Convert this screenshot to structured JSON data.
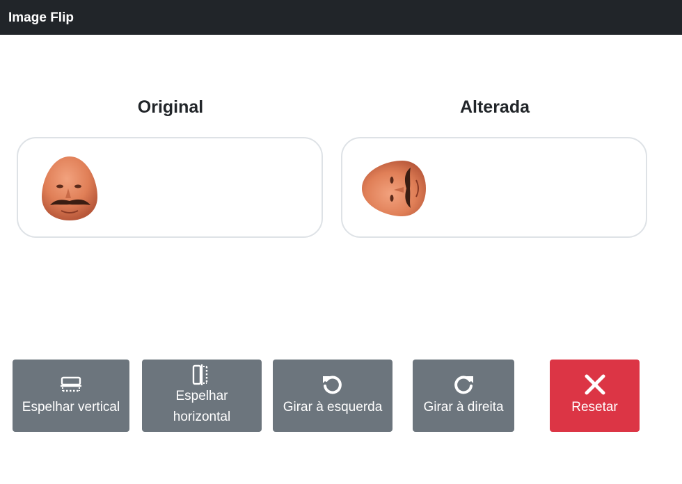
{
  "app": {
    "title": "Image Flip"
  },
  "original": {
    "heading": "Original"
  },
  "altered": {
    "heading": "Alterada"
  },
  "buttons": {
    "mirror_vertical": "Espelhar vertical",
    "mirror_horizontal": "Espelhar horizontal",
    "rotate_left": "Girar à esquerda",
    "rotate_right": "Girar à direita",
    "reset": "Resetar"
  },
  "icons": {
    "mirror_vertical": "flip-vertical-icon",
    "mirror_horizontal": "flip-horizontal-icon",
    "rotate_left": "rotate-left-icon",
    "rotate_right": "rotate-right-icon",
    "reset": "close-icon"
  },
  "colors": {
    "titlebar": "#212529",
    "button": "#6c757d",
    "danger": "#dc3545",
    "panel_border": "#dee2e6"
  }
}
